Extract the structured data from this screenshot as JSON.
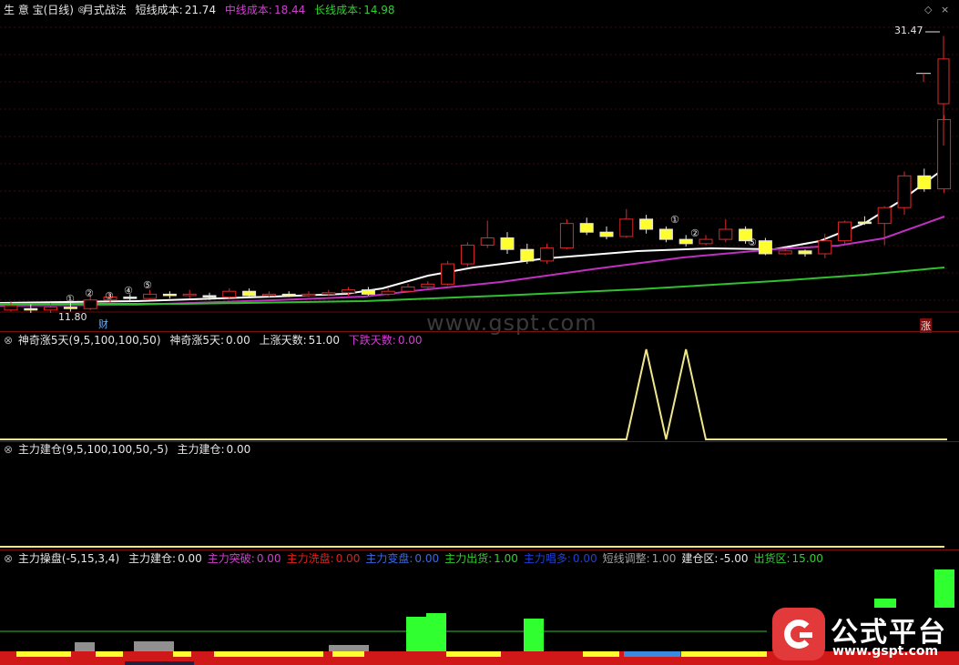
{
  "panels": {
    "main": {
      "stock_name": "生 意 宝(日线)",
      "indicator_name": "月式战法",
      "short_label": "短线成本:",
      "short_value": "21.74",
      "mid_label": "中线成本:",
      "mid_value": "18.44",
      "long_label": "长线成本:",
      "long_value": "14.98",
      "high_label": "31.47",
      "low_label": "11.80",
      "marker_cai": "财",
      "marker_zhang": "涨",
      "circle_marks": [
        "①",
        "②",
        "③",
        "④",
        "⑤",
        "①",
        "②",
        "⑤"
      ]
    },
    "p2": {
      "title": "神奇涨5天(9,5,100,100,50)",
      "a_label": "神奇涨5天:",
      "a_value": "0.00",
      "b_label": "上涨天数:",
      "b_value": "51.00",
      "c_label": "下跌天数:",
      "c_value": "0.00"
    },
    "p3": {
      "title": "主力建仓(9,5,100,100,50,-5)",
      "a_label": "主力建仓:",
      "a_value": "0.00"
    },
    "p4": {
      "title": "主力操盘(-5,15,3,4)",
      "items": [
        {
          "label": "主力建仓:",
          "value": "0.00",
          "color": "#e6e6e6"
        },
        {
          "label": "主力突破:",
          "value": "0.00",
          "color": "#d040d0"
        },
        {
          "label": "主力洗盘:",
          "value": "0.00",
          "color": "#e02020"
        },
        {
          "label": "主力变盘:",
          "value": "0.00",
          "color": "#3a6ae0"
        },
        {
          "label": "主力出货:",
          "value": "1.00",
          "color": "#30d030"
        },
        {
          "label": "主力唱多:",
          "value": "0.00",
          "color": "#2040d0"
        },
        {
          "label": "短线调整:",
          "value": "1.00",
          "color": "#a0a0a0"
        },
        {
          "label": "建仓区:",
          "value": "-5.00",
          "color": "#e6e6e6"
        },
        {
          "label": "出货区:",
          "value": "15.00",
          "color": "#30d030"
        }
      ]
    }
  },
  "watermark": "www.gspt.com",
  "logo": {
    "brand": "公式平台",
    "url": "www.gspt.com"
  },
  "colors": {
    "up": "#e02828",
    "down_fill": "#ffff30",
    "white_line": "#ffffff",
    "mid_line": "#c030c0",
    "long_line": "#30c030",
    "signal": "#f0e68c"
  },
  "chart_data": {
    "type": "candlestick",
    "price_labels": {
      "high": 31.47,
      "low": 11.8
    },
    "moving_averages": [
      {
        "name": "短线成本",
        "last": 21.74
      },
      {
        "name": "中线成本",
        "last": 18.44
      },
      {
        "name": "长线成本",
        "last": 14.98
      }
    ],
    "p2_signal": [
      0,
      0,
      0,
      0,
      0,
      0,
      0,
      0,
      0,
      0,
      0,
      0,
      0,
      0,
      0,
      0,
      0,
      0,
      0,
      0,
      0,
      0,
      0,
      0,
      0,
      0,
      0,
      0,
      0,
      0,
      0,
      0,
      1,
      0,
      1,
      0,
      0,
      0,
      0,
      0,
      0,
      0,
      0,
      0,
      0,
      0,
      0,
      0
    ],
    "p3_line_level": 0
  }
}
